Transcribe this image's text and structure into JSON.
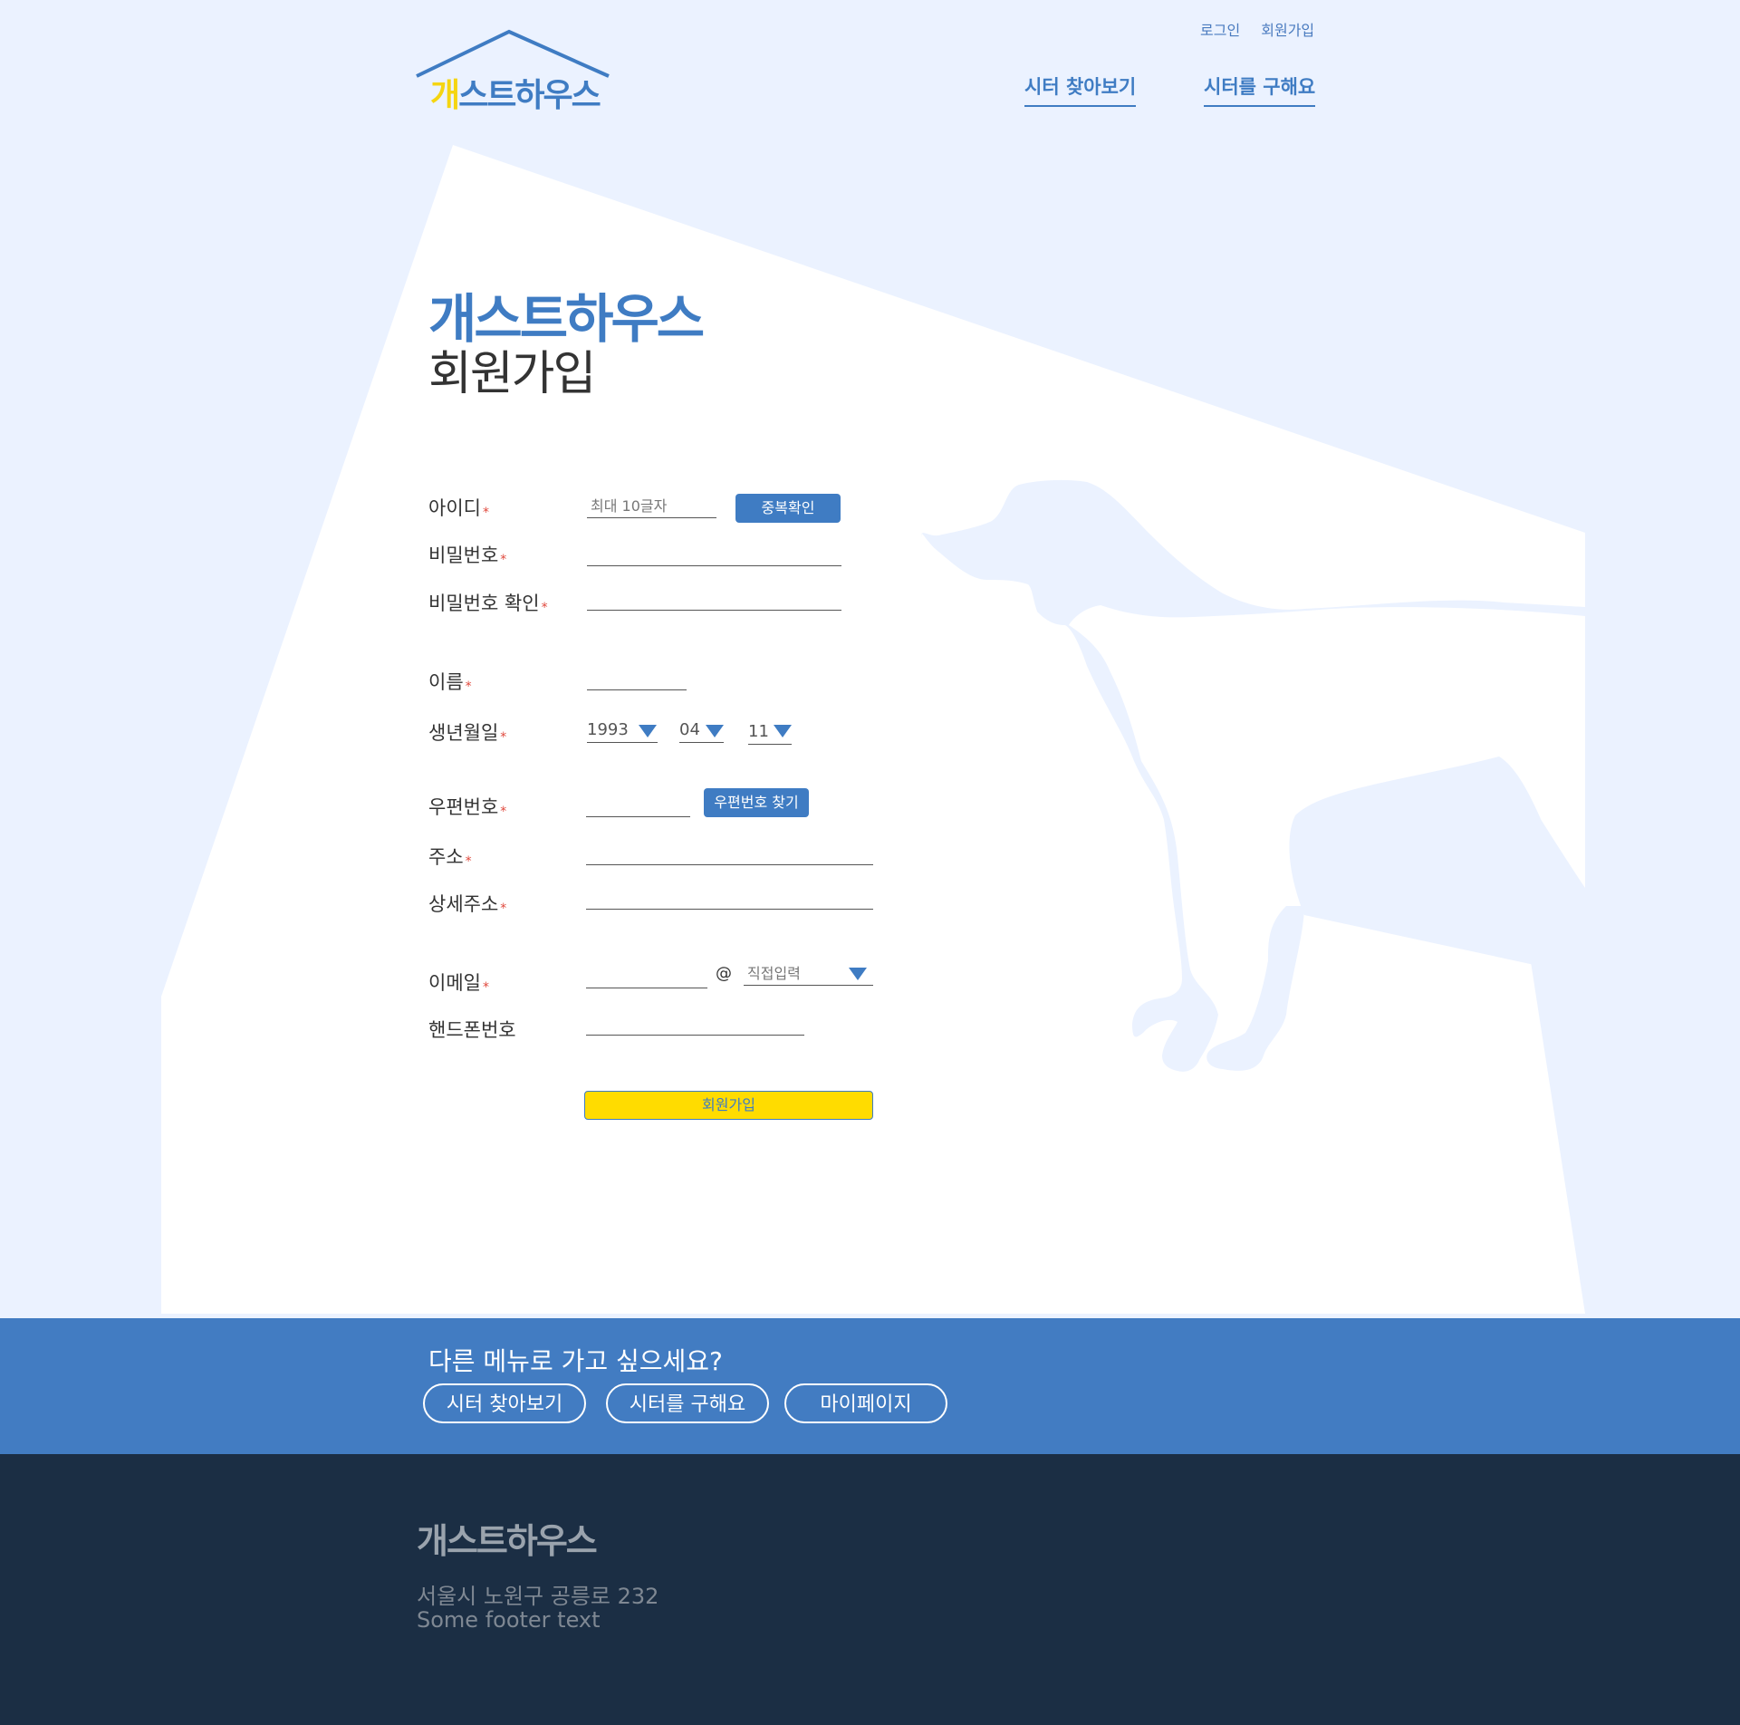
{
  "header": {
    "login": "로그인",
    "signup": "회원가입",
    "logo_first": "개",
    "logo_rest": "스트하우스",
    "nav": [
      "시터 찾아보기",
      "시터를 구해요"
    ]
  },
  "title": {
    "brand": "개스트하우스",
    "page": "회원가입"
  },
  "form": {
    "id_label": "아이디",
    "id_placeholder": "최대 10글자",
    "dup_check": "중복확인",
    "pw_label": "비밀번호",
    "pw_confirm_label": "비밀번호 확인",
    "name_label": "이름",
    "birth_label": "생년월일",
    "birth_year": "1993",
    "birth_month": "04",
    "birth_day": "11",
    "zip_label": "우편번호",
    "zip_search": "우편번호 찾기",
    "addr_label": "주소",
    "addr_detail_label": "상세주소",
    "email_label": "이메일",
    "email_at": "@",
    "email_domain": "직접입력",
    "phone_label": "핸드폰번호",
    "required_mark": "*",
    "submit": "회원가입"
  },
  "band": {
    "question": "다른 메뉴로 가고 싶으세요?",
    "buttons": [
      "시터 찾아보기",
      "시터를 구해요",
      "마이페이지"
    ]
  },
  "footer": {
    "logo": "개스트하우스",
    "address": "서울시 노원구 공릉로 232",
    "text": "Some footer text"
  },
  "colors": {
    "brand_blue": "#3f7cc3",
    "yellow": "#ffdc00",
    "footer_bg": "#1b2e44",
    "page_bg": "#ebf2ff"
  }
}
